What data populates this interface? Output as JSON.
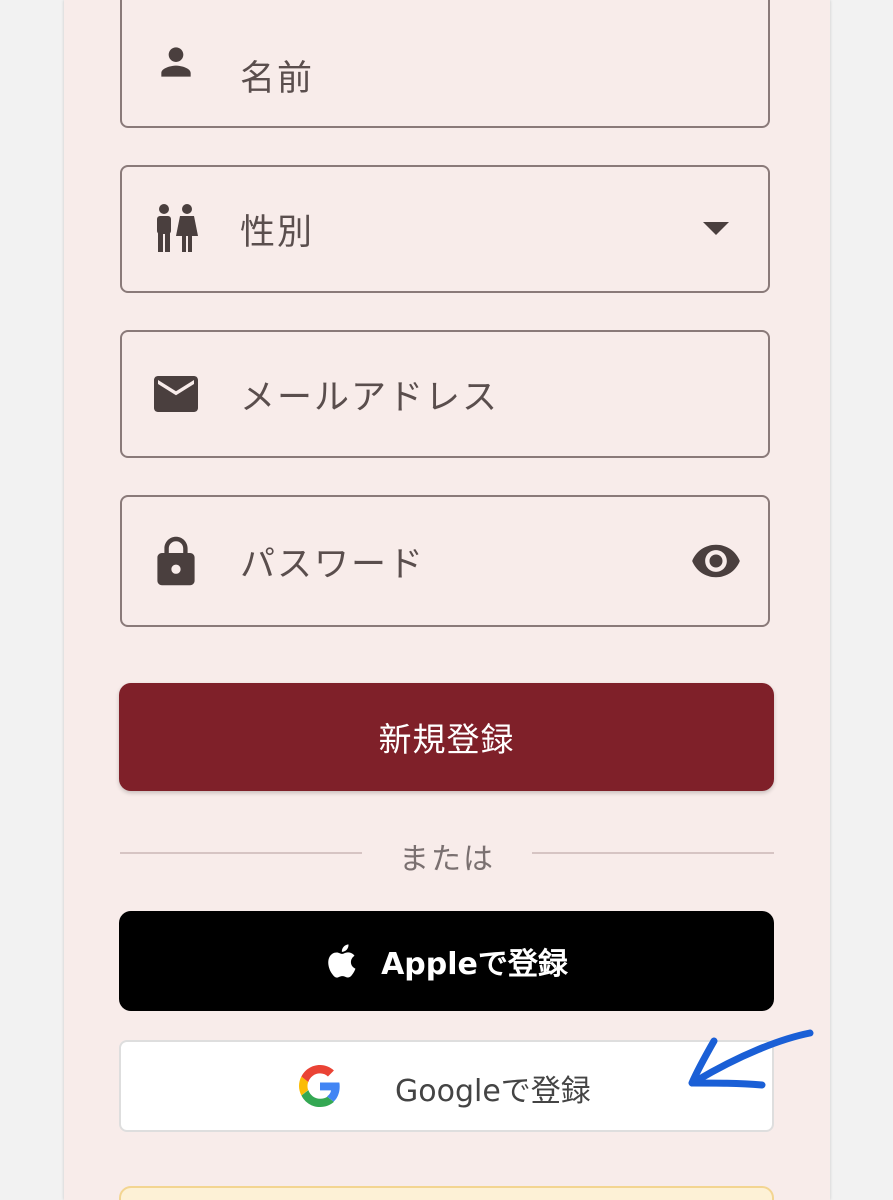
{
  "form": {
    "name_placeholder": "名前",
    "gender_placeholder": "性別",
    "email_placeholder": "メールアドレス",
    "password_placeholder": "パスワード"
  },
  "actions": {
    "register_label": "新規登録",
    "divider_text": "または",
    "apple_label": "Appleで登録",
    "google_label": "Googleで登録"
  },
  "icons": {
    "name": "person-icon",
    "gender": "gender-icon",
    "email": "mail-icon",
    "password": "lock-icon",
    "visibility": "eye-icon",
    "dropdown": "dropdown-arrow-icon",
    "apple": "apple-logo-icon",
    "google": "google-logo-icon"
  },
  "colors": {
    "card_background": "#f8ecea",
    "primary": "#7f2029",
    "field_border": "#8a7a79",
    "annotation": "#1a5fd6"
  }
}
